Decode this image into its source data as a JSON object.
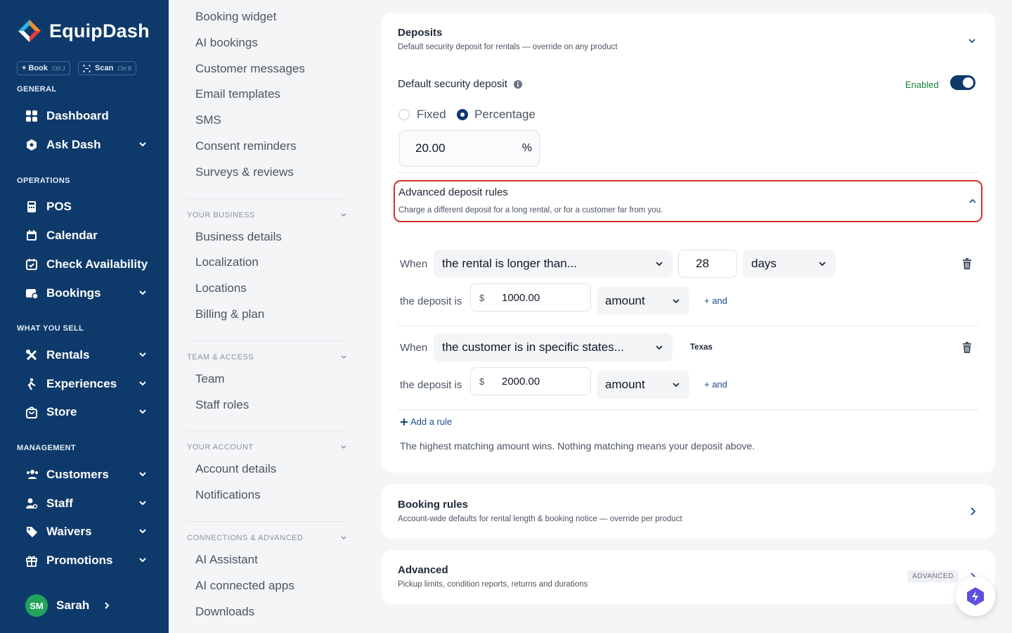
{
  "brand": {
    "name": "EquipDash"
  },
  "quick_actions": [
    {
      "label": "+ Book",
      "shortcut": "Ctrl J"
    },
    {
      "label": "Scan",
      "shortcut": "Ctrl B"
    }
  ],
  "sidebar": {
    "sections": {
      "general": "GENERAL",
      "operations": "OPERATIONS",
      "what_you_sell": "WHAT YOU SELL",
      "management": "MANAGEMENT"
    },
    "items": {
      "dashboard": "Dashboard",
      "ask_dash": "Ask Dash",
      "pos": "POS",
      "calendar": "Calendar",
      "check_availability": "Check Availability",
      "bookings": "Bookings",
      "rentals": "Rentals",
      "experiences": "Experiences",
      "store": "Store",
      "customers": "Customers",
      "staff": "Staff",
      "waivers": "Waivers",
      "promotions": "Promotions"
    },
    "user": {
      "initials": "SM",
      "name": "Sarah"
    }
  },
  "settings_nav": {
    "top_items": [
      "Booking widget",
      "AI bookings",
      "Customer messages",
      "Email templates",
      "SMS",
      "Consent reminders",
      "Surveys & reviews"
    ],
    "groups": {
      "your_business": {
        "title": "YOUR BUSINESS",
        "items": [
          "Business details",
          "Localization",
          "Locations",
          "Billing & plan"
        ]
      },
      "team_access": {
        "title": "TEAM & ACCESS",
        "items": [
          "Team",
          "Staff roles"
        ]
      },
      "your_account": {
        "title": "YOUR ACCOUNT",
        "items": [
          "Account details",
          "Notifications"
        ]
      },
      "connections": {
        "title": "CONNECTIONS & ADVANCED",
        "items": [
          "AI Assistant",
          "AI connected apps",
          "Downloads"
        ]
      }
    }
  },
  "deposits": {
    "title": "Deposits",
    "subtitle": "Default security deposit for rentals — override on any product",
    "default_label": "Default security deposit",
    "enabled_label": "Enabled",
    "enabled": true,
    "options": [
      "Fixed",
      "Percentage"
    ],
    "selected_option": "Percentage",
    "value": "20.00",
    "unit": "%",
    "advanced": {
      "title": "Advanced deposit rules",
      "subtitle": "Charge a different deposit for a long rental, or for a customer far from you."
    },
    "rules": [
      {
        "when_label": "When",
        "condition": "the rental is longer than...",
        "number": "28",
        "period": "days",
        "deposit_label": "the deposit is",
        "currency": "$",
        "amount": "1000.00",
        "amount_type": "amount",
        "and_label": "+ and"
      },
      {
        "when_label": "When",
        "condition": "the customer is in specific states...",
        "state_tag": "Texas",
        "deposit_label": "the deposit is",
        "currency": "$",
        "amount": "2000.00",
        "amount_type": "amount",
        "and_label": "+ and"
      }
    ],
    "add_rule": "Add a rule",
    "footnote": "The highest matching amount wins. Nothing matching means your deposit above."
  },
  "booking_rules": {
    "title": "Booking rules",
    "subtitle": "Account-wide defaults for rental length & booking notice — override per product"
  },
  "advanced": {
    "title": "Advanced",
    "subtitle": "Pickup limits, condition reports, returns and durations",
    "badge": "ADVANCED"
  },
  "colors": {
    "sidebar": "#0e3a6b",
    "accent": "#0e3a6b",
    "enabled_text": "#15803d",
    "highlight": "#d32f2f",
    "avatar": "#22a35a"
  }
}
